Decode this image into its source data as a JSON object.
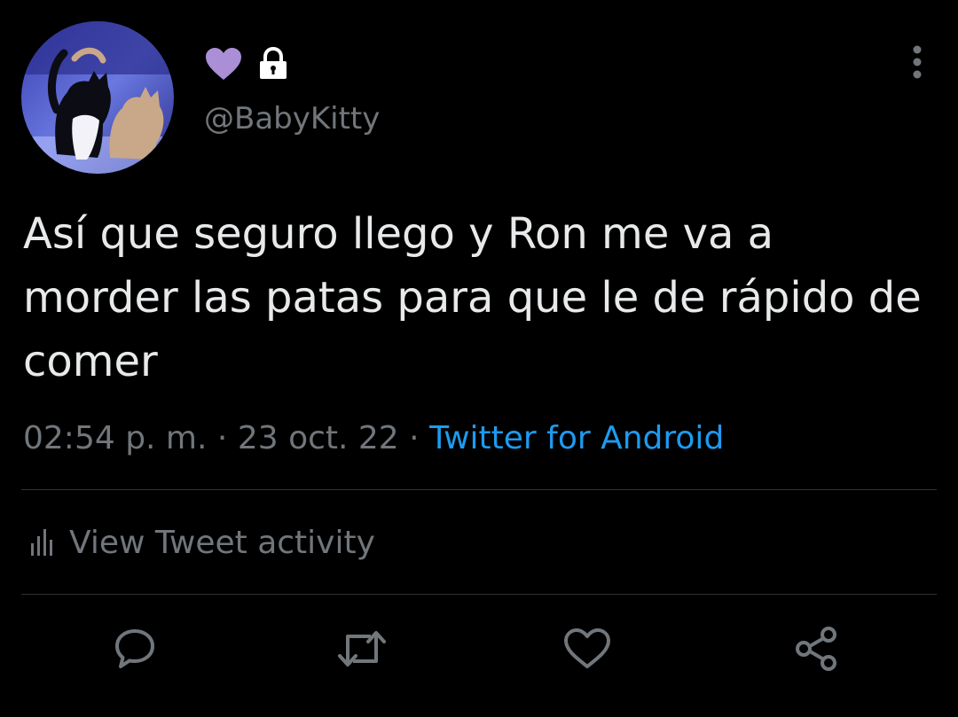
{
  "author": {
    "handle": "@BabyKitty",
    "avatar_icon": "cat-avatar",
    "badges": [
      {
        "name": "purple-heart-icon",
        "color": "#aa8ed6"
      },
      {
        "name": "lock-icon",
        "color": "#ffffff"
      }
    ]
  },
  "tweet": {
    "text": "Así que seguro llego y Ron me va a morder las patas para que le de rápido de comer",
    "time": "02:54 p. m.",
    "separator": "·",
    "date": "23 oct. 22",
    "source": "Twitter for Android"
  },
  "activity": {
    "label": "View Tweet activity",
    "icon": "bar-chart-icon"
  },
  "actions": [
    {
      "name": "reply",
      "icon": "speech-bubble-icon"
    },
    {
      "name": "retweet",
      "icon": "retweet-icon"
    },
    {
      "name": "like",
      "icon": "heart-outline-icon"
    },
    {
      "name": "share",
      "icon": "share-icon"
    }
  ],
  "colors": {
    "background": "#000000",
    "text": "#e7e9ea",
    "secondary": "#71767b",
    "accent": "#1d9bf0",
    "divider": "#2f3336"
  }
}
